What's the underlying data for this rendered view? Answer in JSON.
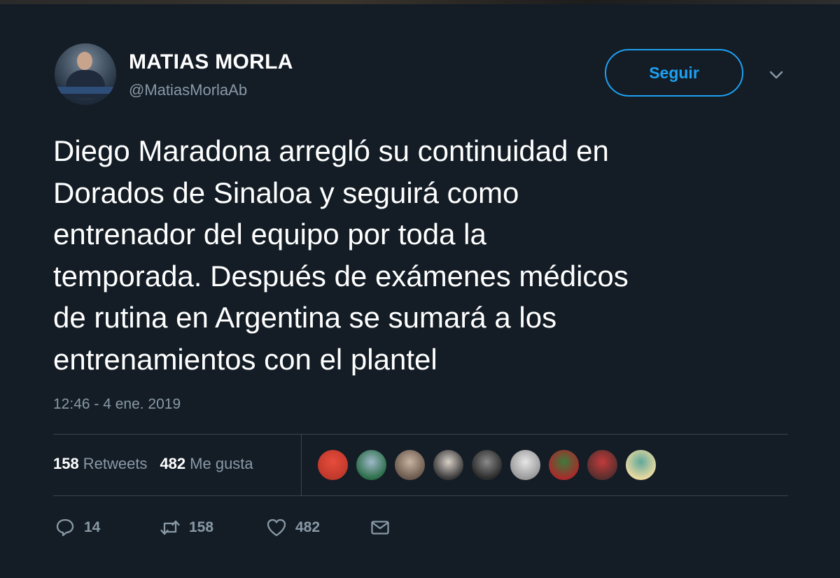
{
  "tweet": {
    "author_name": "MATIAS MORLA",
    "author_handle": "@MatiasMorlaAb",
    "follow_label": "Seguir",
    "text": "Diego Maradona arregló su continuidad en\nDorados de Sinaloa y seguirá como\nentrenador del equipo por toda la\ntemporada. Después de exámenes médicos\nde rutina en Argentina se sumará a los\nentrenamientos con el plantel",
    "timestamp": "12:46 - 4 ene. 2019"
  },
  "stats": {
    "retweets_count": "158",
    "retweets_label": "Retweets",
    "likes_count": "482",
    "likes_label": "Me gusta"
  },
  "likers": [
    {
      "color_a": "#c0392b",
      "color_b": "#e74c3c"
    },
    {
      "color_a": "#2c6e49",
      "color_b": "#9fb8c8"
    },
    {
      "color_a": "#6b5a4e",
      "color_b": "#c7b3a0"
    },
    {
      "color_a": "#3a3a3a",
      "color_b": "#d8d0c8"
    },
    {
      "color_a": "#2b2b2b",
      "color_b": "#8a8a8a"
    },
    {
      "color_a": "#9a9a9a",
      "color_b": "#e6e6e6"
    },
    {
      "color_a": "#a82b2b",
      "color_b": "#3d7a3d"
    },
    {
      "color_a": "#5a2e2e",
      "color_b": "#c23b3b"
    },
    {
      "color_a": "#e8d9a0",
      "color_b": "#5fa89c"
    }
  ],
  "actions": {
    "reply_count": "14",
    "retweet_count": "158",
    "like_count": "482"
  },
  "colors": {
    "background": "#141d26",
    "accent": "#1da1f2",
    "secondary_text": "#8899a6",
    "divider": "#38444d"
  }
}
